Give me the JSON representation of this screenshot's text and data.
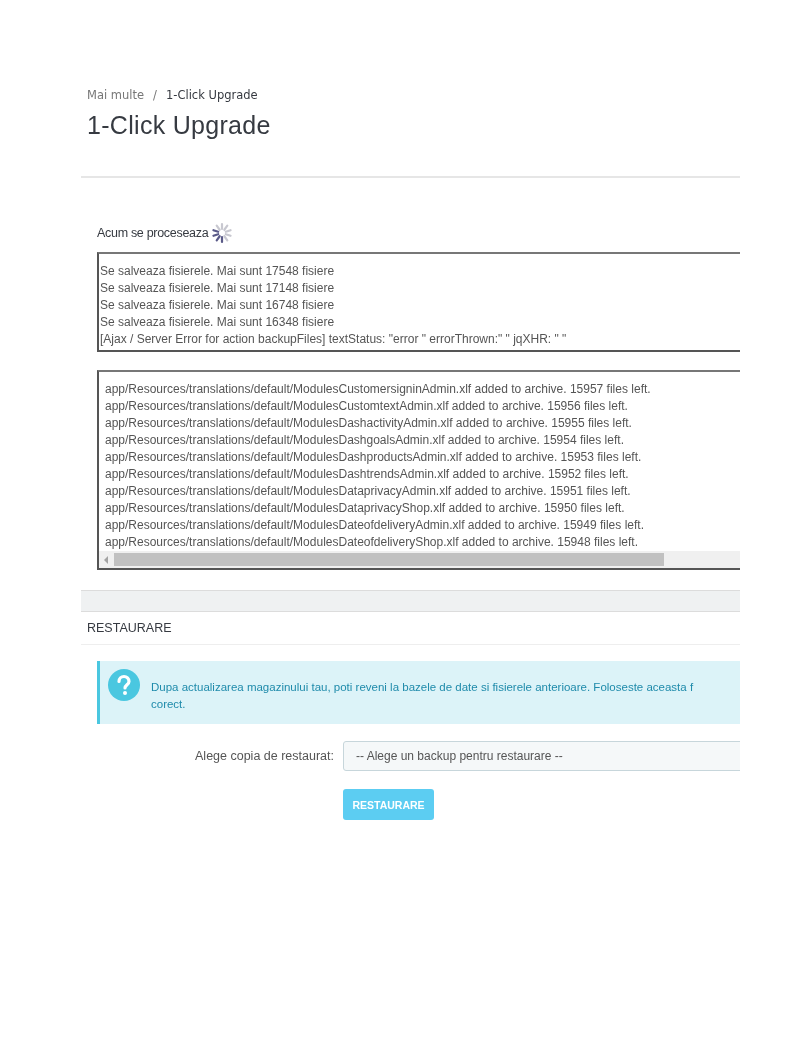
{
  "breadcrumb": [
    {
      "label": "Mai multe",
      "kind": "link"
    },
    {
      "label": "1-Click Upgrade",
      "kind": "current"
    }
  ],
  "separator": "/",
  "title": "1-Click Upgrade",
  "processing": {
    "label": "Acum se proceseaza",
    "busy": true
  },
  "status_log": [
    "Se salveaza fisierele. Mai sunt 17548 fisiere",
    "Se salveaza fisierele. Mai sunt 17148 fisiere",
    "Se salveaza fisierele. Mai sunt 16748 fisiere",
    "Se salveaza fisierele. Mai sunt 16348 fisiere",
    "[Ajax / Server Error for action backupFiles] textStatus: \"error \" errorThrown:\" \" jqXHR: \" \""
  ],
  "file_log": [
    "app/Resources/translations/default/ModulesCustomersigninAdmin.xlf added to archive. 15957 files left.",
    "app/Resources/translations/default/ModulesCustomtextAdmin.xlf added to archive. 15956 files left.",
    "app/Resources/translations/default/ModulesDashactivityAdmin.xlf added to archive. 15955 files left.",
    "app/Resources/translations/default/ModulesDashgoalsAdmin.xlf added to archive. 15954 files left.",
    "app/Resources/translations/default/ModulesDashproductsAdmin.xlf added to archive. 15953 files left.",
    "app/Resources/translations/default/ModulesDashtrendsAdmin.xlf added to archive. 15952 files left.",
    "app/Resources/translations/default/ModulesDataprivacyAdmin.xlf added to archive. 15951 files left.",
    "app/Resources/translations/default/ModulesDataprivacyShop.xlf added to archive. 15950 files left.",
    "app/Resources/translations/default/ModulesDateofdeliveryAdmin.xlf added to archive. 15949 files left.",
    "app/Resources/translations/default/ModulesDateofdeliveryShop.xlf added to archive. 15948 files left."
  ],
  "restore": {
    "heading": "RESTAURARE",
    "alert_lines": [
      "Dupa actualizarea magazinului tau, poti reveni la bazele de date si fisierele anterioare. Foloseste aceasta f",
      "corect."
    ],
    "field_label": "Alege copia de restaurat:",
    "select_value": "-- Alege un backup pentru restaurare --",
    "button": "RESTAURARE"
  }
}
